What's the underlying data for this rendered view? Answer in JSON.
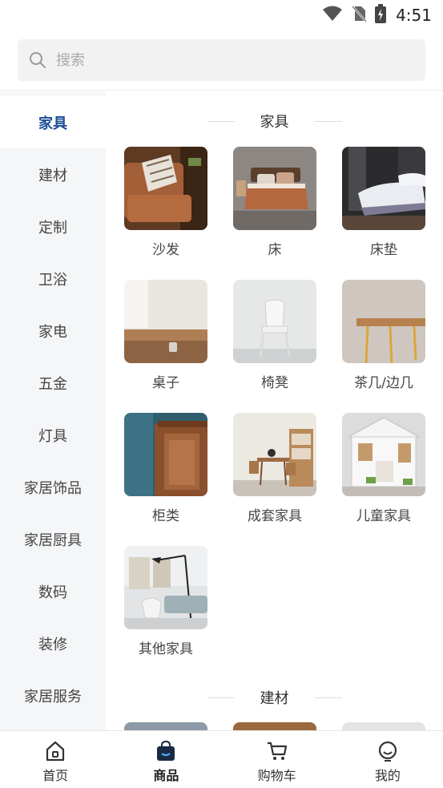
{
  "status_bar": {
    "time": "4:51"
  },
  "search": {
    "placeholder": "搜索"
  },
  "sidebar": {
    "items": [
      {
        "label": "家具",
        "active": true
      },
      {
        "label": "建材"
      },
      {
        "label": "定制"
      },
      {
        "label": "卫浴"
      },
      {
        "label": "家电"
      },
      {
        "label": "五金"
      },
      {
        "label": "灯具"
      },
      {
        "label": "家居饰品"
      },
      {
        "label": "家居厨具"
      },
      {
        "label": "数码"
      },
      {
        "label": "装修"
      },
      {
        "label": "家居服务"
      }
    ]
  },
  "content": {
    "sections": [
      {
        "title": "家具",
        "products": [
          {
            "name": "沙发"
          },
          {
            "name": "床"
          },
          {
            "name": "床垫"
          },
          {
            "name": "桌子"
          },
          {
            "name": "椅凳"
          },
          {
            "name": "茶几/边几"
          },
          {
            "name": "柜类"
          },
          {
            "name": "成套家具"
          },
          {
            "name": "儿童家具"
          },
          {
            "name": "其他家具"
          }
        ]
      },
      {
        "title": "建材",
        "products": []
      }
    ]
  },
  "tabbar": {
    "tabs": [
      {
        "label": "首页",
        "icon": "home-icon"
      },
      {
        "label": "商品",
        "icon": "shopping-bag-icon",
        "active": true
      },
      {
        "label": "购物车",
        "icon": "cart-icon"
      },
      {
        "label": "我的",
        "icon": "profile-icon"
      }
    ]
  },
  "colors": {
    "accent": "#1d4c9a",
    "sidebar_bg": "#f5f6f8"
  }
}
